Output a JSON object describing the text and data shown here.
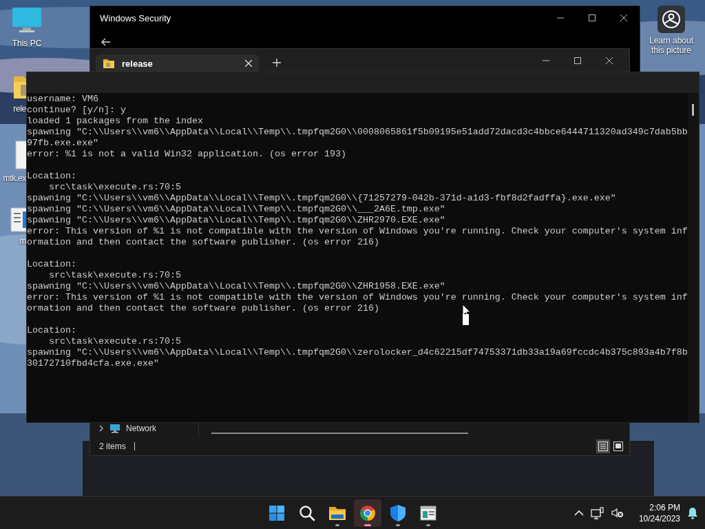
{
  "desktop": {
    "icons": [
      {
        "label": "This PC",
        "kind": "computer"
      },
      {
        "label": "rele",
        "kind": "zip-folder"
      },
      {
        "label": "mtk.ex",
        "kind": "file"
      },
      {
        "label": "m",
        "kind": "document"
      }
    ],
    "spotlight": {
      "label": "Learn about this picture"
    }
  },
  "security_window": {
    "title": "Windows Security"
  },
  "explorer_window": {
    "tabs": [
      {
        "label": "release",
        "selected": true
      }
    ],
    "nav_items": [
      {
        "label": "Network",
        "expanded": false
      }
    ],
    "status": "2 items",
    "view_buttons": [
      {
        "kind": "details",
        "selected": true
      },
      {
        "kind": "tiles",
        "selected": false
      }
    ]
  },
  "terminal": {
    "lines": [
      {
        "kind": "text",
        "text": "username: VM6"
      },
      {
        "kind": "text",
        "text": "continue? [y/n]: y"
      },
      {
        "kind": "text",
        "text": "loaded 1 packages from the index"
      },
      {
        "kind": "text",
        "text": "spawning \"C:\\\\Users\\\\vm6\\\\AppData\\\\Local\\\\Temp\\\\.tmpfqm2G0\\\\0008065861f5b09195e51add72dacd3c4bbce6444711320ad349c7dab5bb"
      },
      {
        "kind": "text",
        "text": "97fb.exe.exe\""
      },
      {
        "kind": "text",
        "text": "error: %1 is not a valid Win32 application. (os error 193)"
      },
      {
        "kind": "blank"
      },
      {
        "kind": "text",
        "text": "Location:"
      },
      {
        "kind": "text",
        "text": "    src\\task\\execute.rs:70:5"
      },
      {
        "kind": "text",
        "text": "spawning \"C:\\\\Users\\\\vm6\\\\AppData\\\\Local\\\\Temp\\\\.tmpfqm2G0\\\\{71257279-042b-371d-a1d3-fbf8d2fadffa}.exe.exe\""
      },
      {
        "kind": "text",
        "text": "spawning \"C:\\\\Users\\\\vm6\\\\AppData\\\\Local\\\\Temp\\\\.tmpfqm2G0\\\\___2A6E.tmp.exe\""
      },
      {
        "kind": "text",
        "text": "spawning \"C:\\\\Users\\\\vm6\\\\AppData\\\\Local\\\\Temp\\\\.tmpfqm2G0\\\\ZHR2970.EXE.exe\""
      },
      {
        "kind": "text",
        "text": "error: This version of %1 is not compatible with the version of Windows you're running. Check your computer's system inf"
      },
      {
        "kind": "text",
        "text": "ormation and then contact the software publisher. (os error 216)"
      },
      {
        "kind": "blank"
      },
      {
        "kind": "text",
        "text": "Location:"
      },
      {
        "kind": "text",
        "text": "    src\\task\\execute.rs:70:5"
      },
      {
        "kind": "text",
        "text": "spawning \"C:\\\\Users\\\\vm6\\\\AppData\\\\Local\\\\Temp\\\\.tmpfqm2G0\\\\ZHR1958.EXE.exe\""
      },
      {
        "kind": "text",
        "text": "error: This version of %1 is not compatible with the version of Windows you're running. Check your computer's system inf"
      },
      {
        "kind": "text",
        "text": "ormation and then contact the software publisher. (os error 216)"
      },
      {
        "kind": "blank"
      },
      {
        "kind": "text",
        "text": "Location:"
      },
      {
        "kind": "text",
        "text": "    src\\task\\execute.rs:70:5"
      },
      {
        "kind": "text",
        "text": "spawning \"C:\\\\Users\\\\vm6\\\\AppData\\\\Local\\\\Temp\\\\.tmpfqm2G0\\\\zerolocker_d4c62215df74753371db33a19a69fccdc4b375c893a4b7f8b"
      },
      {
        "kind": "text",
        "text": "30172710fbd4cfa.exe.exe\""
      }
    ]
  },
  "taskbar": {
    "apps": [
      {
        "kind": "start",
        "running": false,
        "selected": false
      },
      {
        "kind": "search",
        "running": false,
        "selected": false
      },
      {
        "kind": "explorer",
        "running": true,
        "selected": false
      },
      {
        "kind": "browser",
        "running": true,
        "selected": true
      },
      {
        "kind": "security",
        "running": true,
        "selected": false
      },
      {
        "kind": "app",
        "running": true,
        "selected": false
      }
    ],
    "clock": {
      "time": "2:06 PM",
      "date": "10/24/2023"
    }
  }
}
